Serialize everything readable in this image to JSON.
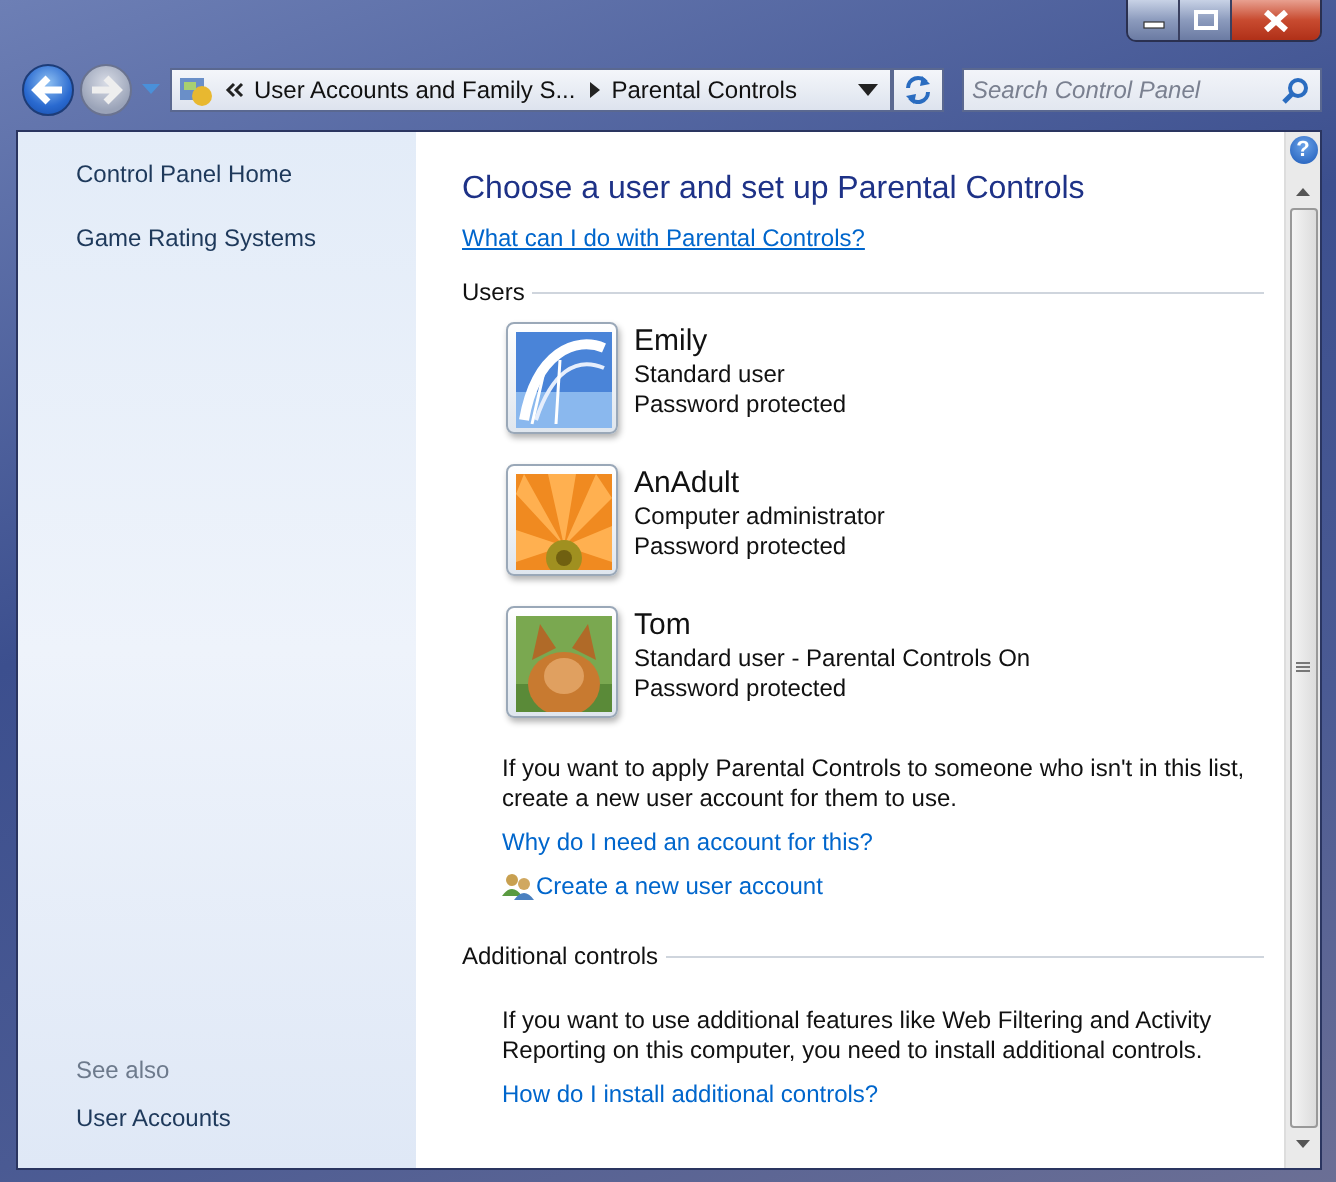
{
  "address_bar": {
    "breadcrumbs": [
      "User Accounts and Family S...",
      "Parental Controls"
    ]
  },
  "search": {
    "placeholder": "Search Control Panel"
  },
  "sidebar": {
    "items": [
      "Control Panel Home",
      "Game Rating Systems"
    ],
    "see_also_label": "See also",
    "see_also_items": [
      "User Accounts"
    ]
  },
  "help_button": "?",
  "heading": "Choose a user and set up Parental Controls",
  "heading_link": "What can I do with Parental Controls?",
  "users_section": {
    "title": "Users",
    "users": [
      {
        "name": "Emily",
        "role": "Standard user",
        "status": "Password protected"
      },
      {
        "name": "AnAdult",
        "role": "Computer administrator",
        "status": "Password protected"
      },
      {
        "name": "Tom",
        "role": "Standard user - Parental Controls On",
        "status": "Password protected"
      }
    ],
    "note": "If you want to apply Parental Controls to someone who isn't in this list, create a new user account for them to use.",
    "links": [
      "Why do I need an account for this?"
    ],
    "create_link": "Create a new user account"
  },
  "additional_section": {
    "title": "Additional controls",
    "note": "If you want to use additional features like Web Filtering and Activity Reporting on this computer, you need to install additional controls.",
    "links": [
      "How do I install additional controls?"
    ]
  }
}
